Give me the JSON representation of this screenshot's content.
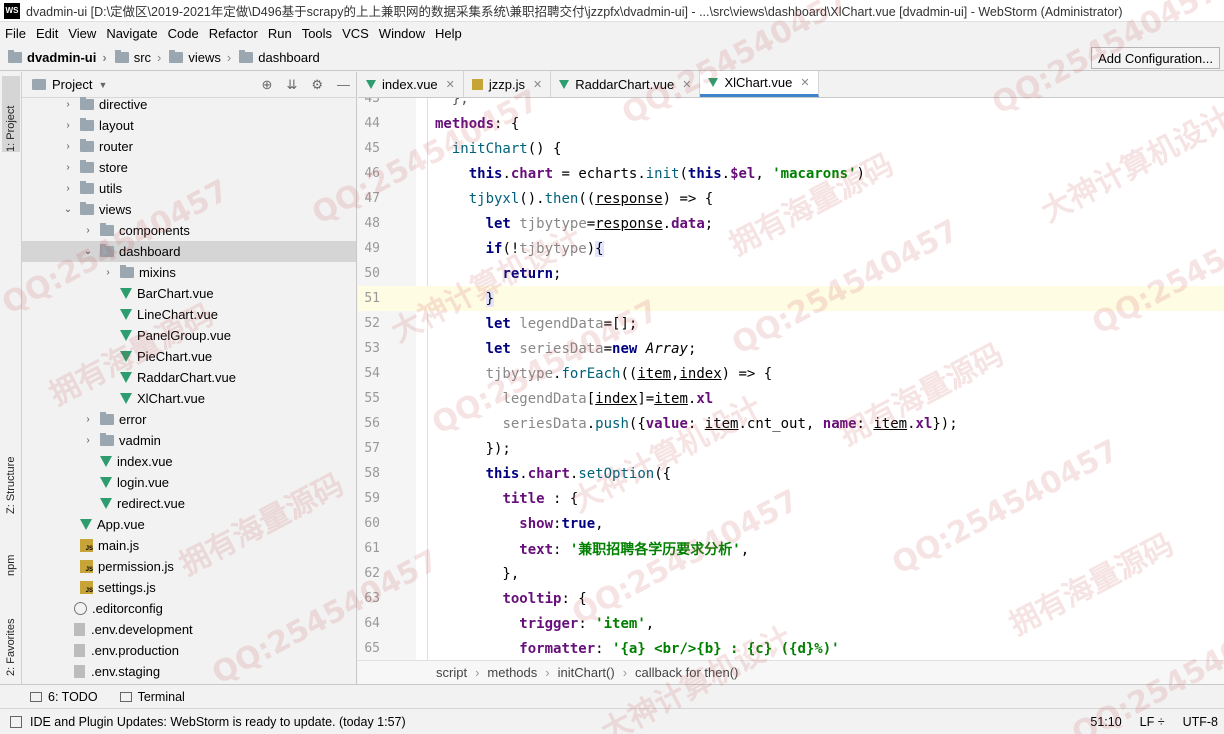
{
  "window": {
    "logo": "WS",
    "title": "dvadmin-ui [D:\\定做区\\2019-2021年定做\\D496基于scrapy的上上兼职网的数据采集系统\\兼职招聘交付\\jzzpfx\\dvadmin-ui] - ...\\src\\views\\dashboard\\XlChart.vue [dvadmin-ui] - WebStorm (Administrator)"
  },
  "menu": [
    {
      "label": "File"
    },
    {
      "label": "Edit"
    },
    {
      "label": "View"
    },
    {
      "label": "Navigate"
    },
    {
      "label": "Code"
    },
    {
      "label": "Refactor"
    },
    {
      "label": "Run"
    },
    {
      "label": "Tools"
    },
    {
      "label": "VCS"
    },
    {
      "label": "Window"
    },
    {
      "label": "Help"
    }
  ],
  "navbar": {
    "crumbs": [
      "dvadmin-ui",
      "src",
      "views",
      "dashboard"
    ],
    "add_config": "Add Configuration..."
  },
  "left_strip": {
    "project_tab": "1: Project",
    "structure_tab": "Z: Structure",
    "npm_tab": "npm",
    "favorites_tab": "2: Favorites"
  },
  "project_panel": {
    "title": "Project",
    "tree": [
      {
        "label": "directive",
        "type": "folder",
        "depth": 2,
        "arrow": "›"
      },
      {
        "label": "layout",
        "type": "folder",
        "depth": 2,
        "arrow": "›"
      },
      {
        "label": "router",
        "type": "folder",
        "depth": 2,
        "arrow": "›"
      },
      {
        "label": "store",
        "type": "folder",
        "depth": 2,
        "arrow": "›"
      },
      {
        "label": "utils",
        "type": "folder",
        "depth": 2,
        "arrow": "›"
      },
      {
        "label": "views",
        "type": "folder",
        "depth": 2,
        "arrow": "⌄"
      },
      {
        "label": "components",
        "type": "folder",
        "depth": 3,
        "arrow": "›"
      },
      {
        "label": "dashboard",
        "type": "folder",
        "depth": 3,
        "arrow": "⌄",
        "selected": true
      },
      {
        "label": "mixins",
        "type": "folder",
        "depth": 4,
        "arrow": "›"
      },
      {
        "label": "BarChart.vue",
        "type": "vue",
        "depth": 4
      },
      {
        "label": "LineChart.vue",
        "type": "vue",
        "depth": 4
      },
      {
        "label": "PanelGroup.vue",
        "type": "vue",
        "depth": 4
      },
      {
        "label": "PieChart.vue",
        "type": "vue",
        "depth": 4
      },
      {
        "label": "RaddarChart.vue",
        "type": "vue",
        "depth": 4
      },
      {
        "label": "XlChart.vue",
        "type": "vue",
        "depth": 4
      },
      {
        "label": "error",
        "type": "folder",
        "depth": 3,
        "arrow": "›"
      },
      {
        "label": "vadmin",
        "type": "folder",
        "depth": 3,
        "arrow": "›"
      },
      {
        "label": "index.vue",
        "type": "vue",
        "depth": 3
      },
      {
        "label": "login.vue",
        "type": "vue",
        "depth": 3
      },
      {
        "label": "redirect.vue",
        "type": "vue",
        "depth": 3
      },
      {
        "label": "App.vue",
        "type": "vue",
        "depth": 2
      },
      {
        "label": "main.js",
        "type": "js",
        "depth": 2
      },
      {
        "label": "permission.js",
        "type": "js",
        "depth": 2
      },
      {
        "label": "settings.js",
        "type": "js",
        "depth": 2
      },
      {
        "label": ".editorconfig",
        "type": "cfg",
        "depth": 1
      },
      {
        "label": ".env.development",
        "type": "env",
        "depth": 1
      },
      {
        "label": ".env.production",
        "type": "env",
        "depth": 1
      },
      {
        "label": ".env.staging",
        "type": "env",
        "depth": 1
      }
    ]
  },
  "tabs": [
    {
      "label": "index.vue",
      "icon": "vue"
    },
    {
      "label": "jzzp.js",
      "icon": "js"
    },
    {
      "label": "RaddarChart.vue",
      "icon": "vue"
    },
    {
      "label": "XlChart.vue",
      "icon": "vue",
      "active": true
    }
  ],
  "editor": {
    "lines": [
      {
        "n": "43",
        "html": "  <span class=\"gray\">},</span>"
      },
      {
        "n": "44",
        "html": "<span class=\"prop\">methods</span>: {"
      },
      {
        "n": "45",
        "html": "  <span class=\"fn\">initChart</span>() {"
      },
      {
        "n": "46",
        "html": "    <span class=\"kw\">this</span>.<span class=\"prop\">chart</span> = echarts.<span class=\"fn\">init</span>(<span class=\"kw\">this</span>.<span class=\"prop\">$el</span>, <span class=\"str\">'macarons'</span>)"
      },
      {
        "n": "47",
        "html": "    <span class=\"fn\">tjbyxl</span>().<span class=\"fn\">then</span>((<u>response</u>) => {"
      },
      {
        "n": "48",
        "html": "      <span class=\"kw\">let</span> <span class=\"dim\">tjbytype</span>=<u>response</u>.<span class=\"prop\">data</span>;"
      },
      {
        "n": "49",
        "html": "      <span class=\"kw\">if</span>(!<span class=\"dim\">tjbytype</span>)<span class=\"hl\">{</span>"
      },
      {
        "n": "50",
        "html": "        <span class=\"kw\">return</span>;"
      },
      {
        "n": "51",
        "html": "      <span class=\"hl\">}</span>",
        "current": true
      },
      {
        "n": "52",
        "html": "      <span class=\"kw\">let</span> <span class=\"dim\">legendData</span>=[];"
      },
      {
        "n": "53",
        "html": "      <span class=\"kw\">let</span> <span class=\"dim\">seriesData</span>=<span class=\"kw\">new</span> <span class=\"ital\">Array</span>;"
      },
      {
        "n": "54",
        "html": "      <span class=\"dim\">tjbytype</span>.<span class=\"fn\">forEach</span>((<u>item</u>,<u>index</u>) => {"
      },
      {
        "n": "55",
        "html": "        <span class=\"dim\">legendData</span>[<u>index</u>]=<u>item</u>.<span class=\"prop\">xl</span>"
      },
      {
        "n": "56",
        "html": "        <span class=\"dim\">seriesData</span>.<span class=\"fn\">push</span>({<span class=\"prop\">value</span>: <u>item</u>.cnt_out, <span class=\"prop\">name</span>: <u>item</u>.<span class=\"prop\">xl</span>});"
      },
      {
        "n": "57",
        "html": "      });"
      },
      {
        "n": "58",
        "html": "      <span class=\"kw\">this</span>.<span class=\"prop\">chart</span>.<span class=\"fn\">setOption</span>({"
      },
      {
        "n": "59",
        "html": "        <span class=\"prop\">title</span> : {"
      },
      {
        "n": "60",
        "html": "          <span class=\"prop\">show</span>:<span class=\"kw\">true</span>,"
      },
      {
        "n": "61",
        "html": "          <span class=\"prop\">text</span>: <span class=\"str\">'兼职招聘各学历要求分析'</span>,"
      },
      {
        "n": "62",
        "html": "        },"
      },
      {
        "n": "63",
        "html": "        <span class=\"prop\">tooltip</span>: {"
      },
      {
        "n": "64",
        "html": "          <span class=\"prop\">trigger</span>: <span class=\"str\">'item'</span>,"
      },
      {
        "n": "65",
        "html": "          <span class=\"prop\">formatter</span>: <span class=\"str\">'{a} &lt;br/&gt;{b} : {c} ({d}%)'</span>"
      }
    ]
  },
  "breadcrumbs": [
    "script",
    "methods",
    "initChart()",
    "callback for then()"
  ],
  "bottom_tools": [
    {
      "label": "6: TODO"
    },
    {
      "label": "Terminal"
    }
  ],
  "status": {
    "message": "IDE and Plugin Updates: WebStorm is ready to update. (today 1:57)",
    "position": "51:10",
    "line_sep": "LF ÷",
    "encoding": "UTF-8"
  },
  "watermark": {
    "qq": "QQ:254540457",
    "cn1": "拥有海量源码",
    "cn2": "大神计算机设计"
  }
}
